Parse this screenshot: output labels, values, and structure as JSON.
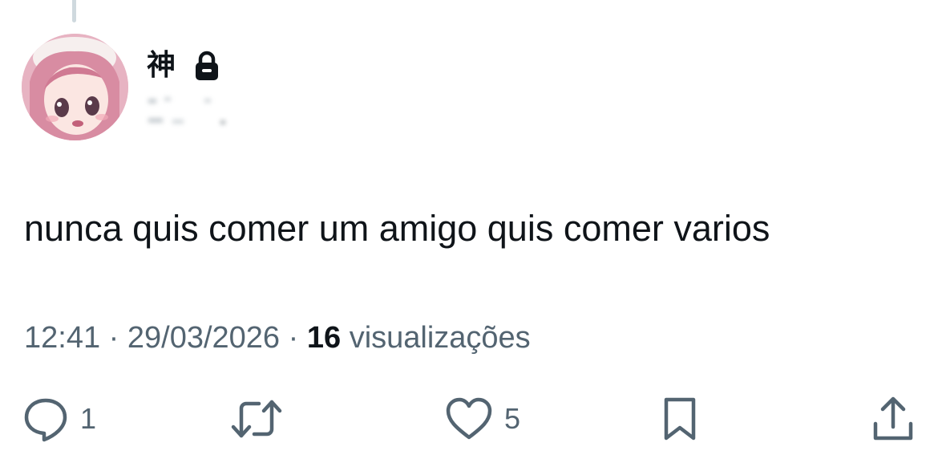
{
  "post": {
    "display_name": "神",
    "text": "nunca quis comer um amigo quis comer varios",
    "time": "12:41",
    "date": "29/03/2026",
    "separator": "·",
    "views_count": "16",
    "views_label": "visualizações"
  },
  "actions": {
    "reply_count": "1",
    "like_count": "5"
  },
  "icons": {
    "protected": "lock-icon",
    "reply": "speech-bubble-icon",
    "retweet": "retweet-icon",
    "like": "heart-icon",
    "bookmark": "bookmark-icon",
    "share": "share-icon"
  },
  "colors": {
    "text": "#0f1419",
    "secondary": "#536471",
    "thread_line": "#cfd9de"
  }
}
